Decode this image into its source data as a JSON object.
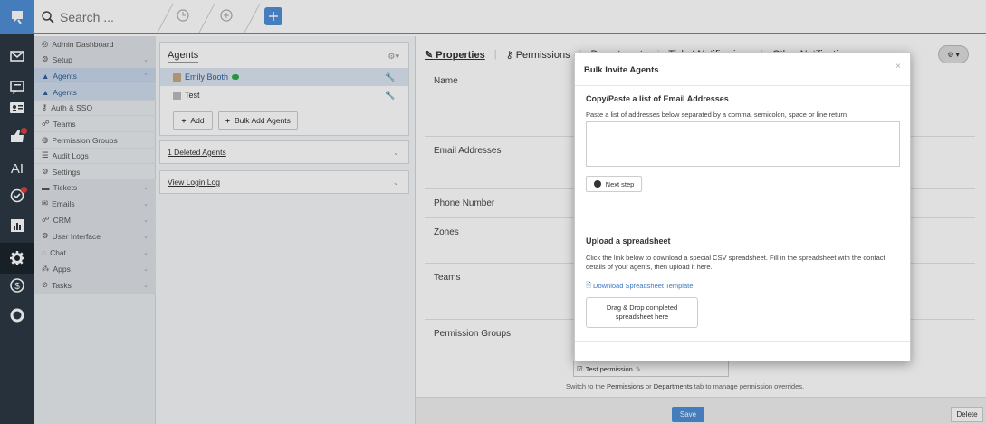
{
  "topbar": {
    "search_placeholder": "Search ..."
  },
  "rail": {
    "icons": [
      "logo-icon",
      "mail-icon",
      "chat-window-icon",
      "contact-card-icon",
      "thumbs-up-icon",
      "ai-icon",
      "check-circle-icon",
      "reports-icon",
      "gear-icon",
      "billing-icon",
      "lifebuoy-icon"
    ],
    "ai_label": "AI",
    "accent_color": "#4f8fd6"
  },
  "sidenav": {
    "admin_dashboard": "Admin Dashboard",
    "setup": "Setup",
    "agents_group": "Agents",
    "agents": "Agents",
    "auth_sso": "Auth & SSO",
    "teams": "Teams",
    "permission_groups": "Permission Groups",
    "audit_logs": "Audit Logs",
    "settings": "Settings",
    "tickets": "Tickets",
    "emails": "Emails",
    "crm": "CRM",
    "user_interface": "User Interface",
    "chat": "Chat",
    "apps": "Apps",
    "tasks": "Tasks"
  },
  "agents_panel": {
    "title": "Agents",
    "rows": [
      {
        "name": "Emily Booth"
      },
      {
        "name": "Test"
      }
    ],
    "add_label": "Add",
    "bulk_add_label": "Bulk Add Agents",
    "deleted_label": "1 Deleted Agents",
    "login_log_label": "View Login Log"
  },
  "detail": {
    "tabs": [
      "Properties",
      "Permissions",
      "Departments",
      "Ticket Notifications",
      "Other Notifications"
    ],
    "fields": [
      "Name",
      "Email Addresses",
      "Phone Number",
      "Zones",
      "Teams",
      "Permission Groups"
    ],
    "perm_value": "Test permission",
    "perm_hint_pre": "Switch to the",
    "perm_hint_link1": "Permissions",
    "perm_hint_mid": "or",
    "perm_hint_link2": "Departments",
    "perm_hint_post": "tab to manage permission overrides.",
    "save_label": "Save",
    "delete_label": "Delete"
  },
  "modal": {
    "title": "Bulk Invite Agents",
    "close": "×",
    "copy_heading": "Copy/Paste a list of Email Addresses",
    "copy_help": "Paste a list of addresses below separated by a comma, semicolon, space or line return",
    "next_label": "Next step",
    "upload_heading": "Upload a spreadsheet",
    "upload_help": "Click the link below to download a special CSV spreadsheet. Fill in the spreadsheet with the contact details of your agents, then upload it here.",
    "download_label": "Download Spreadsheet Template",
    "dropzone_line1": "Drag & Drop completed",
    "dropzone_line2": "spreadsheet here"
  }
}
